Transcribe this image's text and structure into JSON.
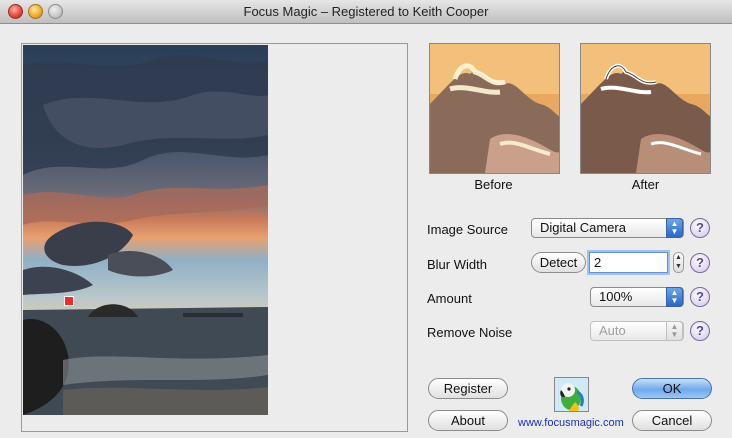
{
  "window": {
    "title": "Focus Magic – Registered to Keith Cooper"
  },
  "thumbnails": {
    "before_label": "Before",
    "after_label": "After"
  },
  "controls": {
    "image_source": {
      "label": "Image Source",
      "value": "Digital Camera"
    },
    "blur_width": {
      "label": "Blur Width",
      "detect_label": "Detect",
      "value": "2"
    },
    "amount": {
      "label": "Amount",
      "value": "100%"
    },
    "remove_noise": {
      "label": "Remove Noise",
      "value": "Auto"
    }
  },
  "help_symbol": "?",
  "buttons": {
    "register": "Register",
    "about": "About",
    "ok": "OK",
    "cancel": "Cancel"
  },
  "website": "www.focusmagic.com",
  "colors": {
    "accent": "#2767c8",
    "link": "#1a2fb5",
    "focus_marker": "#e8302a"
  }
}
